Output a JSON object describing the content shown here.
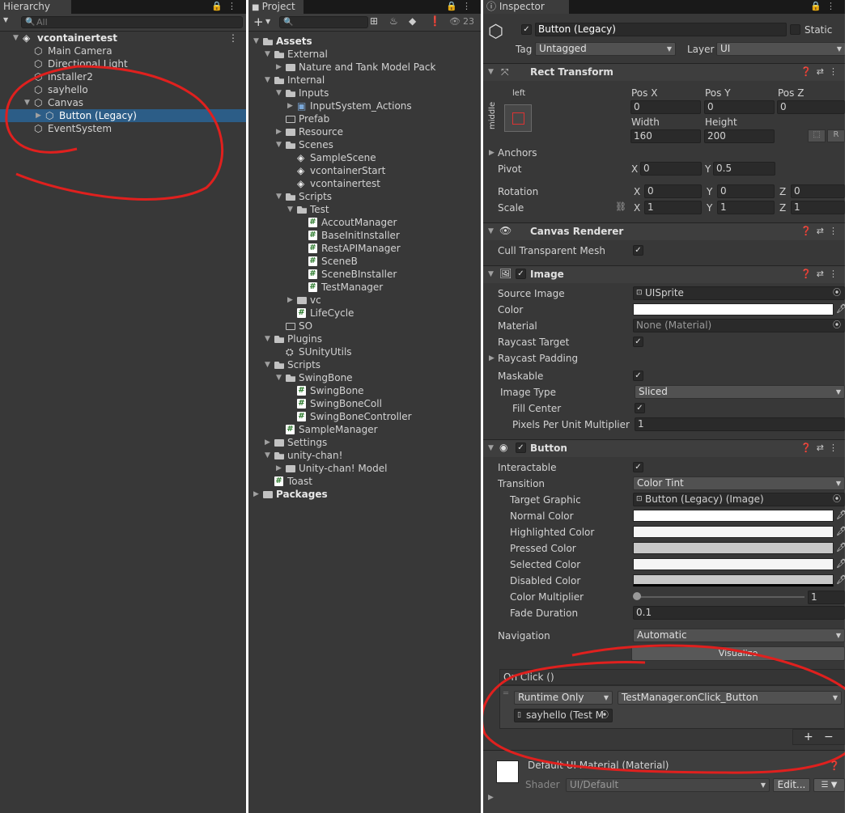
{
  "hierarchy": {
    "tab": "Hierarchy",
    "search_placeholder": "All",
    "scene": "vcontainertest",
    "items": [
      "Main Camera",
      "Directional Light",
      "installer2",
      "sayhello",
      "Canvas",
      "Button (Legacy)",
      "EventSystem"
    ]
  },
  "project": {
    "tab": "Project",
    "count": "23",
    "add": "+",
    "tree": {
      "assets": "Assets",
      "external": "External",
      "nature": "Nature and Tank Model Pack",
      "internal": "Internal",
      "inputs": "Inputs",
      "inputsys": "InputSystem_Actions",
      "prefab": "Prefab",
      "resource": "Resource",
      "scenes": "Scenes",
      "s1": "SampleScene",
      "s2": "vcontainerStart",
      "s3": "vcontainertest",
      "scripts": "Scripts",
      "test": "Test",
      "t1": "AccoutManager",
      "t2": "BaseInitInstaller",
      "t3": "RestAPIManager",
      "t4": "SceneB",
      "t5": "SceneBInstaller",
      "t6": "TestManager",
      "vc": "vc",
      "lifecycle": "LifeCycle",
      "so": "SO",
      "plugins": "Plugins",
      "sunity": "SUnityUtils",
      "scripts2": "Scripts",
      "swingbone": "SwingBone",
      "sb1": "SwingBone",
      "sb2": "SwingBoneColl",
      "sb3": "SwingBoneController",
      "samplemanager": "SampleManager",
      "settings": "Settings",
      "unitychan": "unity-chan!",
      "unitychanmodel": "Unity-chan! Model",
      "toast": "Toast",
      "packages": "Packages"
    }
  },
  "inspector": {
    "tab": "Inspector",
    "object_name": "Button (Legacy)",
    "static_label": "Static",
    "tag_label": "Tag",
    "tag_value": "Untagged",
    "layer_label": "Layer",
    "layer_value": "UI",
    "rect": {
      "title": "Rect Transform",
      "anchor_h": "left",
      "anchor_v": "middle",
      "posx_label": "Pos X",
      "posy_label": "Pos Y",
      "posz_label": "Pos Z",
      "posx": "0",
      "posy": "0",
      "posz": "0",
      "width_label": "Width",
      "height_label": "Height",
      "width": "160",
      "height": "200",
      "r_label": "R",
      "anchors": "Anchors",
      "pivot": "Pivot",
      "pivot_x": "0",
      "pivot_y": "0.5",
      "rotation": "Rotation",
      "rot_x": "0",
      "rot_y": "0",
      "rot_z": "0",
      "scale": "Scale",
      "scale_x": "1",
      "scale_y": "1",
      "scale_z": "1",
      "x": "X",
      "y": "Y",
      "z": "Z"
    },
    "canvas_renderer": {
      "title": "Canvas Renderer",
      "cull": "Cull Transparent Mesh"
    },
    "image": {
      "title": "Image",
      "source_label": "Source Image",
      "source": "UISprite",
      "color_label": "Color",
      "material_label": "Material",
      "material": "None (Material)",
      "raycast_label": "Raycast Target",
      "raycast_padding": "Raycast Padding",
      "maskable": "Maskable",
      "image_type_label": "Image Type",
      "image_type": "Sliced",
      "fill_center": "Fill Center",
      "ppu_label": "Pixels Per Unit Multiplier",
      "ppu": "1"
    },
    "button": {
      "title": "Button",
      "interactable": "Interactable",
      "transition_label": "Transition",
      "transition": "Color Tint",
      "target_label": "Target Graphic",
      "target": "Button (Legacy) (Image)",
      "normal": "Normal Color",
      "highlighted": "Highlighted Color",
      "pressed": "Pressed Color",
      "selected": "Selected Color",
      "disabled": "Disabled Color",
      "multiplier_label": "Color Multiplier",
      "multiplier": "1",
      "fade_label": "Fade Duration",
      "fade": "0.1",
      "navigation_label": "Navigation",
      "navigation": "Automatic",
      "visualize": "Visualize",
      "onclick": "On Click ()",
      "runtime": "Runtime Only",
      "function": "TestManager.onClick_Button",
      "object": "sayhello (Test M",
      "plus": "+",
      "minus": "−"
    },
    "material": {
      "name": "Default UI Material (Material)",
      "shader_label": "Shader",
      "shader": "UI/Default",
      "edit": "Edit..."
    }
  },
  "colors": {
    "selection": "#2c5d87",
    "annotation": "#e0201e"
  }
}
